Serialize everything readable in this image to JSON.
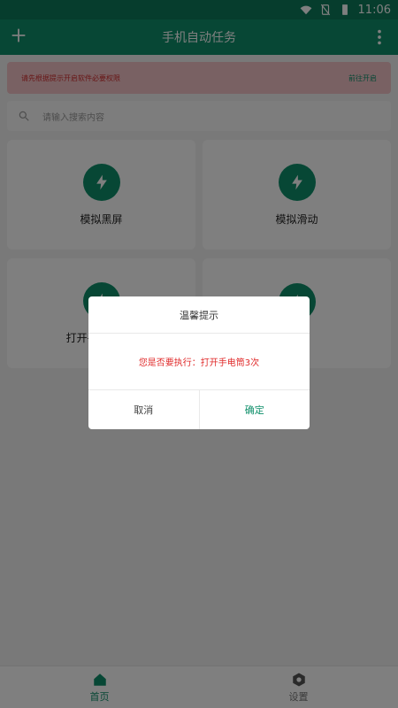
{
  "status_bar": {
    "time": "11:06",
    "icons": [
      "wifi-icon",
      "no-sim-icon",
      "battery-icon"
    ]
  },
  "app_bar": {
    "title": "手机自动任务",
    "left_icon": "plus-icon",
    "right_icon": "more-vert-icon"
  },
  "warning": {
    "message": "请先根据提示开启软件必要权限",
    "action": "前往开启"
  },
  "search": {
    "placeholder": "请输入搜索内容",
    "icon": "search-icon"
  },
  "cards": [
    {
      "label": "模拟黑屏",
      "icon": "lightning-icon"
    },
    {
      "label": "模拟滑动",
      "icon": "lightning-icon"
    },
    {
      "label": "打开手电筒3次",
      "icon": "lightning-icon"
    },
    {
      "label": "%",
      "icon": "lightning-icon"
    }
  ],
  "tabs": [
    {
      "label": "首页",
      "icon": "home-icon",
      "active": true
    },
    {
      "label": "设置",
      "icon": "settings-icon",
      "active": false
    }
  ],
  "dialog": {
    "title": "温馨提示",
    "message": "您是否要执行：打开手电筒3次",
    "cancel": "取消",
    "confirm": "确定"
  },
  "colors": {
    "primary": "#0e8f6a",
    "status_bar": "#0c7a5a",
    "warning_bg": "#f2c2c7",
    "warning_text": "#d12e2e"
  }
}
